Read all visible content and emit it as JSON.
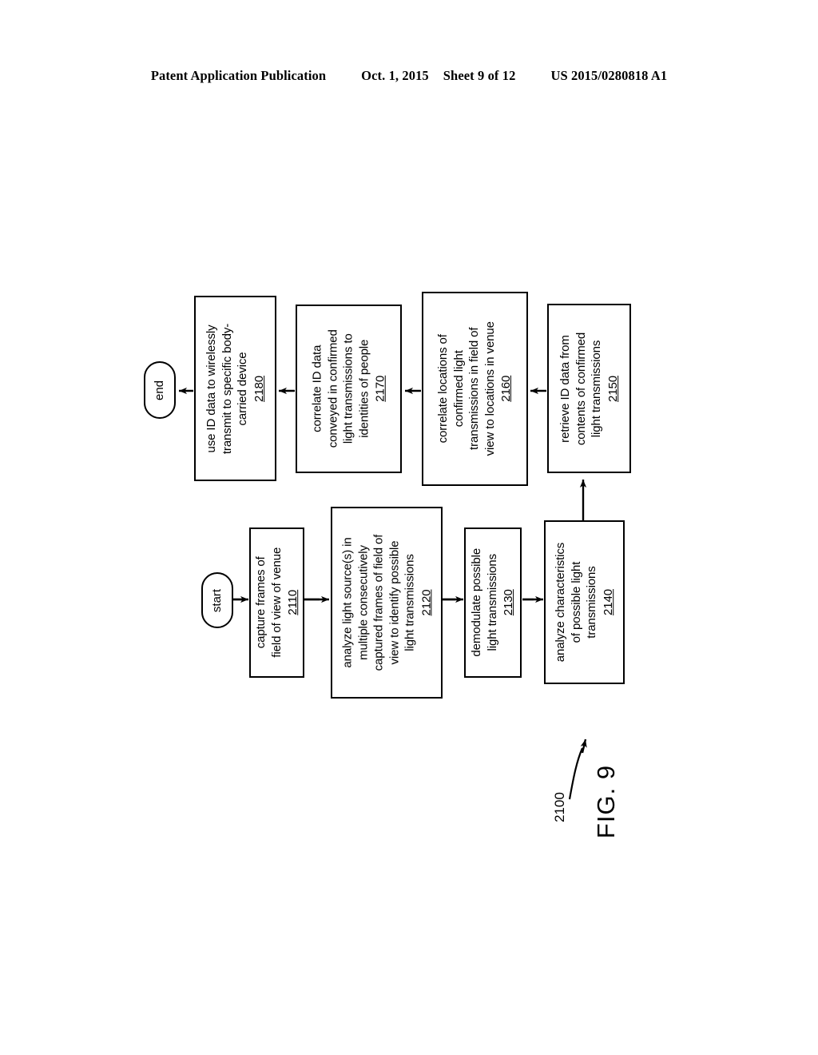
{
  "header": {
    "publication": "Patent Application Publication",
    "date": "Oct. 1, 2015",
    "sheet": "Sheet 9 of 12",
    "doc_id": "US 2015/0280818 A1"
  },
  "figure": {
    "caption": "FIG. 9",
    "ref_numeral": "2100"
  },
  "terminals": {
    "start": "start",
    "end": "end"
  },
  "boxes": {
    "b2110": {
      "lines": [
        "capture frames of",
        "field of view of venue"
      ],
      "num": "2110"
    },
    "b2120": {
      "lines": [
        "analyze light source(s) in",
        "multiple consecutively",
        "captured frames of field of",
        "view to identify possible",
        "light transmissions"
      ],
      "num": "2120"
    },
    "b2130": {
      "lines": [
        "demodulate possible",
        "light transmissions"
      ],
      "num": "2130"
    },
    "b2140": {
      "lines": [
        "analyze characteristics",
        "of possible light",
        "transmissions"
      ],
      "num": "2140"
    },
    "b2150": {
      "lines": [
        "retrieve ID data from",
        "contents of confirmed",
        "light transmissions"
      ],
      "num": "2150"
    },
    "b2160": {
      "lines": [
        "correlate locations of",
        "confirmed light",
        "transmissions in field of",
        "view to locations in venue"
      ],
      "num": "2160"
    },
    "b2170": {
      "lines": [
        "correlate ID data",
        "conveyed in confirmed",
        "light transmissions to",
        "identities of people"
      ],
      "num": "2170"
    },
    "b2180": {
      "lines": [
        "use ID data to wirelessly",
        "transmit to specific body-",
        "carried device"
      ],
      "num": "2180"
    }
  },
  "chart_data": {
    "type": "diagram",
    "title": "FIG. 9",
    "ref_numeral": "2100",
    "nodes": [
      {
        "id": "start",
        "shape": "terminal",
        "label": "start"
      },
      {
        "id": "2110",
        "shape": "process",
        "label": "capture frames of field of view of venue"
      },
      {
        "id": "2120",
        "shape": "process",
        "label": "analyze light source(s) in multiple consecutively captured frames of field of view to identify possible light transmissions"
      },
      {
        "id": "2130",
        "shape": "process",
        "label": "demodulate possible light transmissions"
      },
      {
        "id": "2140",
        "shape": "process",
        "label": "analyze characteristics of possible light transmissions"
      },
      {
        "id": "2150",
        "shape": "process",
        "label": "retrieve ID data from contents of confirmed light transmissions"
      },
      {
        "id": "2160",
        "shape": "process",
        "label": "correlate locations of confirmed light transmissions in field of view to locations in venue"
      },
      {
        "id": "2170",
        "shape": "process",
        "label": "correlate ID data conveyed in confirmed light transmissions to identities of people"
      },
      {
        "id": "2180",
        "shape": "process",
        "label": "use ID data to wirelessly transmit to specific body-carried device"
      },
      {
        "id": "end",
        "shape": "terminal",
        "label": "end"
      }
    ],
    "edges": [
      {
        "from": "start",
        "to": "2110"
      },
      {
        "from": "2110",
        "to": "2120"
      },
      {
        "from": "2120",
        "to": "2130"
      },
      {
        "from": "2130",
        "to": "2140"
      },
      {
        "from": "2140",
        "to": "2150"
      },
      {
        "from": "2150",
        "to": "2160"
      },
      {
        "from": "2160",
        "to": "2170"
      },
      {
        "from": "2170",
        "to": "2180"
      },
      {
        "from": "2180",
        "to": "end"
      }
    ]
  }
}
